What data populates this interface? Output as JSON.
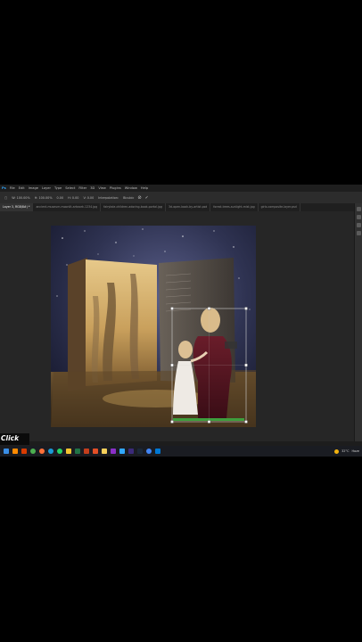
{
  "app": {
    "name": "Photoshop",
    "logo_text": "Ps",
    "menu_items": [
      "File",
      "Edit",
      "Image",
      "Layer",
      "Type",
      "Select",
      "Filter",
      "3D",
      "View",
      "Plugins",
      "Window",
      "Help"
    ]
  },
  "options_bar": {
    "fields": [
      "W: 100.00%",
      "H: 100.00%",
      "0.00",
      "H: 0.00",
      "V: 0.00",
      "Interpolation:",
      "Bicubic"
    ],
    "cancel_icon": "cancel-icon",
    "commit_icon": "checkmark-icon"
  },
  "tabs": [
    {
      "label": "Layer 3, RGB/8#) *",
      "active": true
    },
    {
      "label": "ancient-museum-moonlit-artwork-1234.jpg",
      "active": false
    },
    {
      "label": "fairytale-children-adoring-book-portal.jpg",
      "active": false
    },
    {
      "label": "3d-open-book-by-artist.psd",
      "active": false
    },
    {
      "label": "forest-trees-sunlight-mist.jpg",
      "active": false
    },
    {
      "label": "girls-composite-layer.psd",
      "active": false
    }
  ],
  "caption": {
    "text": "Click"
  },
  "taskbar": {
    "icons": [
      "windows-icon",
      "search-icon",
      "vlc-icon",
      "office-icon",
      "chrome-icon",
      "firefox-icon",
      "edge-icon",
      "whatsapp-icon",
      "file-explorer-icon",
      "excel-icon",
      "powerpoint-icon",
      "app-icon",
      "sticky-notes-icon",
      "app-icon-2",
      "photoshop-icon",
      "after-effects-icon",
      "steam-icon",
      "chrome-icon-2",
      "photos-icon"
    ],
    "weather": "32°C",
    "weather_condition": "Haze"
  },
  "colors": {
    "ps_background": "#262626",
    "transform_handles": "#ffffff",
    "grass_selection": "#3cb043"
  }
}
